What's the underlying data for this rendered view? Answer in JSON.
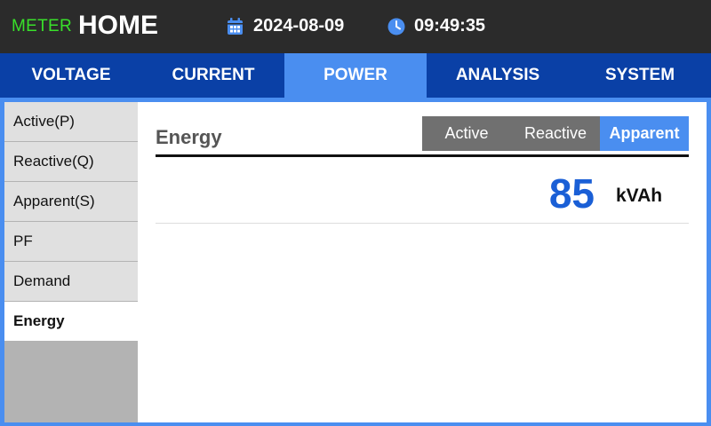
{
  "header": {
    "brand_small": "METER",
    "brand_large": "HOME",
    "date": "2024-08-09",
    "time": "09:49:35",
    "date_icon": "calendar-icon",
    "time_icon": "clock-icon"
  },
  "tabs": [
    {
      "label": "VOLTAGE",
      "active": false
    },
    {
      "label": "CURRENT",
      "active": false
    },
    {
      "label": "POWER",
      "active": true
    },
    {
      "label": "ANALYSIS",
      "active": false
    },
    {
      "label": "SYSTEM",
      "active": false
    }
  ],
  "sidebar": {
    "items": [
      {
        "label": "Active(P)",
        "active": false
      },
      {
        "label": "Reactive(Q)",
        "active": false
      },
      {
        "label": "Apparent(S)",
        "active": false
      },
      {
        "label": "PF",
        "active": false
      },
      {
        "label": "Demand",
        "active": false
      },
      {
        "label": "Energy",
        "active": true
      }
    ]
  },
  "main": {
    "title": "Energy",
    "segments": [
      {
        "label": "Active",
        "active": false
      },
      {
        "label": "Reactive",
        "active": false
      },
      {
        "label": "Apparent",
        "active": true
      }
    ],
    "reading": {
      "value": "85",
      "unit": "kVAh"
    }
  },
  "colors": {
    "header_bg": "#2b2b2b",
    "brand_green": "#39e02a",
    "tab_bar": "#0a40a6",
    "accent_blue": "#4a8ef0",
    "value_blue": "#1a5fd6",
    "segment_gray": "#707070"
  }
}
